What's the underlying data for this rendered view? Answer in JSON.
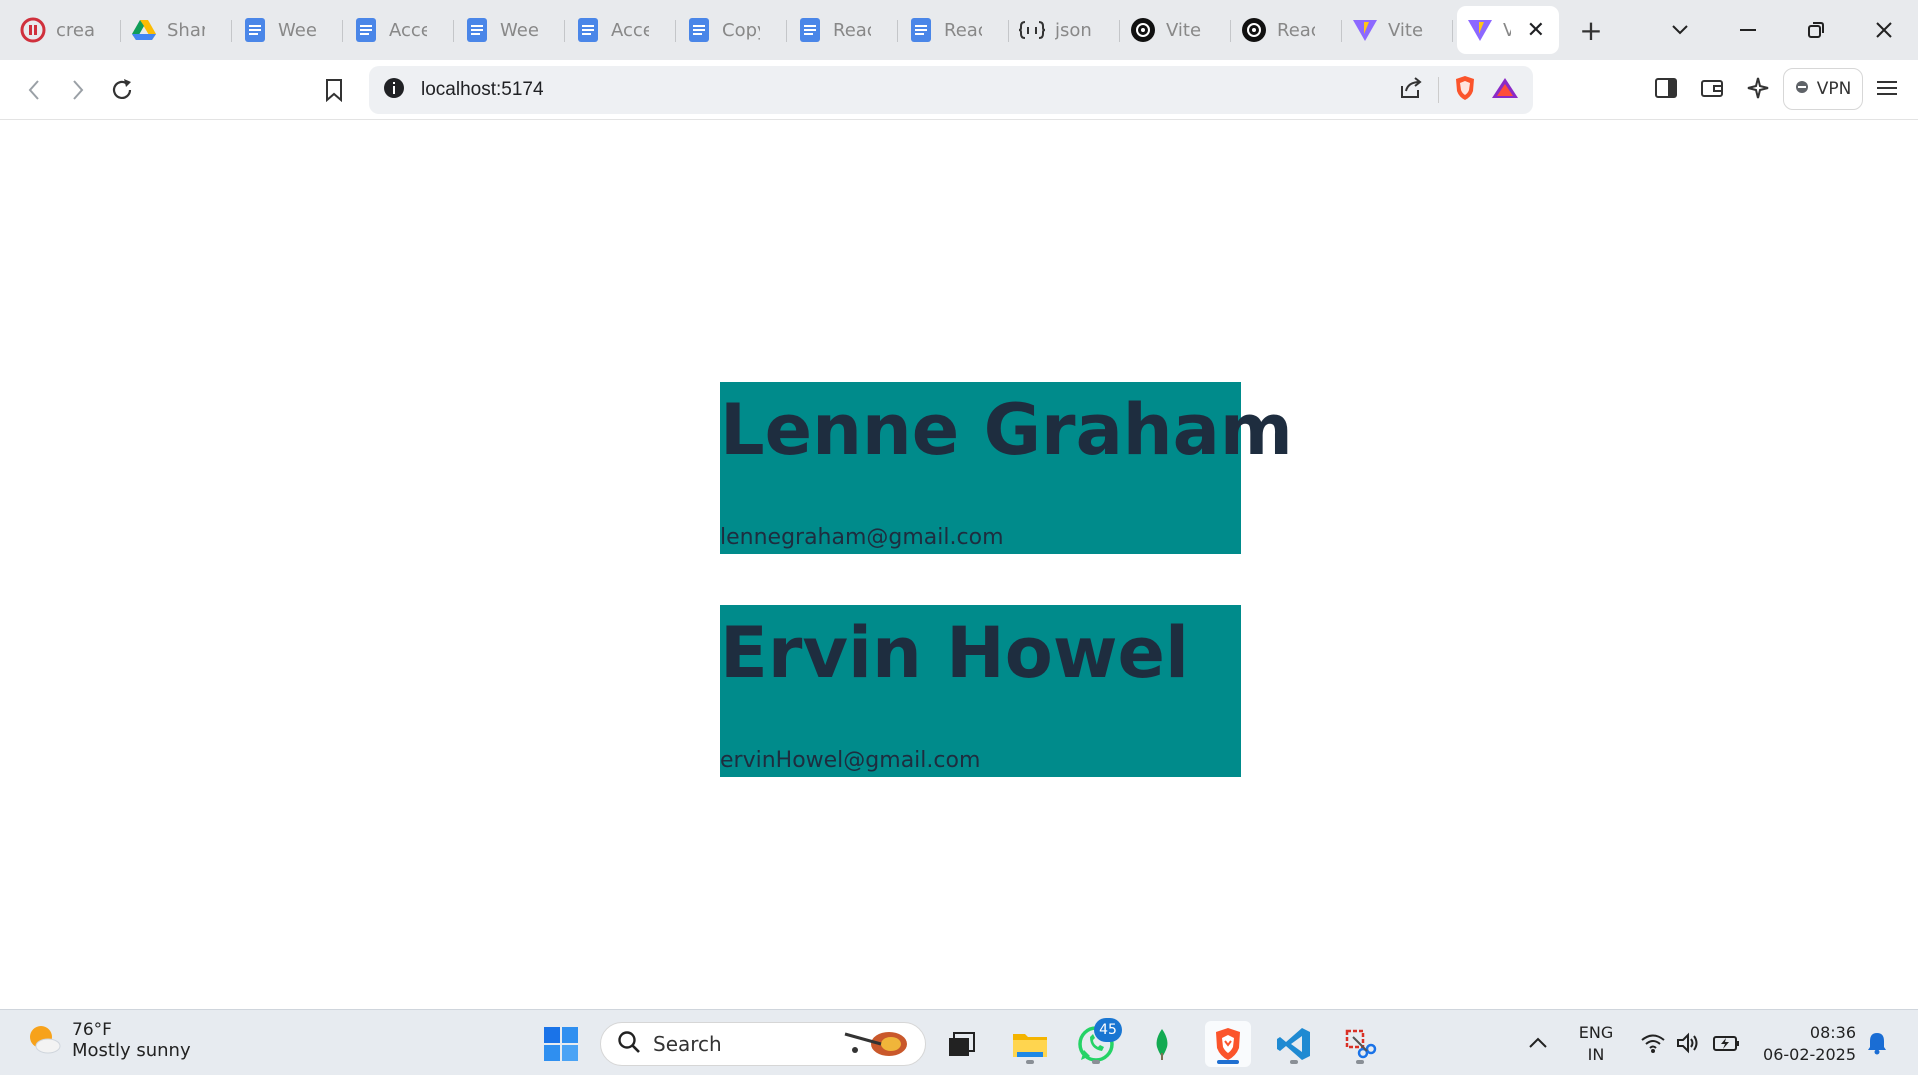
{
  "browser": {
    "tabs": [
      {
        "label": "creat",
        "icon": "ai-logo-icon"
      },
      {
        "label": "Shar",
        "icon": "google-drive-icon"
      },
      {
        "label": "Weel",
        "icon": "google-docs-icon"
      },
      {
        "label": "Acce",
        "icon": "google-docs-icon"
      },
      {
        "label": "Weel",
        "icon": "google-docs-icon"
      },
      {
        "label": "Acce",
        "icon": "google-docs-icon"
      },
      {
        "label": "Copy",
        "icon": "google-docs-icon"
      },
      {
        "label": "Reac",
        "icon": "google-docs-icon"
      },
      {
        "label": "Reac",
        "icon": "google-docs-icon"
      },
      {
        "label": "json",
        "icon": "json-placeholder-icon"
      },
      {
        "label": "Vite",
        "icon": "openai-icon"
      },
      {
        "label": "Reac",
        "icon": "openai-icon"
      },
      {
        "label": "Vite",
        "icon": "vite-icon"
      }
    ],
    "active_tab": {
      "label": "V",
      "icon": "vite-icon",
      "close": "✕"
    },
    "new_tab": "+",
    "url": "localhost:5174",
    "vpn_label": "VPN",
    "colors": {
      "tabstrip": "#e8eaed",
      "accent_brave": "#fb542b"
    }
  },
  "page": {
    "cards": [
      {
        "name": "Lenne Graham",
        "email": "lennegraham@gmail.com"
      },
      {
        "name": "Ervin Howel",
        "email": "ervinHowel@gmail.com"
      }
    ],
    "colors": {
      "card_background": "#008b8b",
      "card_text": "#1e2d3f"
    }
  },
  "taskbar": {
    "weather_temp": "76°F",
    "weather_desc": "Mostly sunny",
    "search_label": "Search",
    "whatsapp_badge": "45",
    "lang_line1": "ENG",
    "lang_line2": "IN",
    "time": "08:36",
    "date": "06-02-2025"
  }
}
